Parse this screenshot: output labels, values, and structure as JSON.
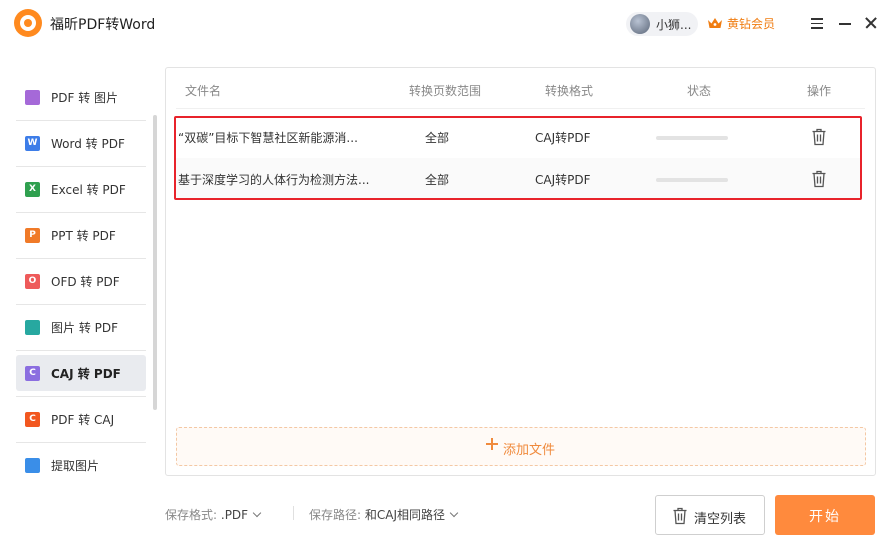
{
  "app": {
    "title": "福昕PDF转Word"
  },
  "user": {
    "name": "小狮..."
  },
  "vip": {
    "label": "黄钻会员",
    "color": "#f07d12"
  },
  "sidebar": {
    "items": [
      {
        "label": "PDF 转 图片",
        "icon": "image-icon",
        "color": "#a569d8",
        "glyph": ""
      },
      {
        "label": "Word 转 PDF",
        "icon": "word-icon",
        "color": "#3d7de8",
        "glyph": "W"
      },
      {
        "label": "Excel 转 PDF",
        "icon": "excel-icon",
        "color": "#2fa04f",
        "glyph": "X"
      },
      {
        "label": "PPT 转 PDF",
        "icon": "ppt-icon",
        "color": "#f07a28",
        "glyph": "P"
      },
      {
        "label": "OFD 转 PDF",
        "icon": "ofd-icon",
        "color": "#ee5a5a",
        "glyph": "O"
      },
      {
        "label": "图片 转 PDF",
        "icon": "picture-icon",
        "color": "#27a8a0",
        "glyph": ""
      },
      {
        "label": "CAJ 转 PDF",
        "icon": "caj-icon",
        "color": "#8b6ee0",
        "glyph": "C",
        "active": true
      },
      {
        "label": "PDF 转 CAJ",
        "icon": "caj-out-icon",
        "color": "#f2571f",
        "glyph": "C"
      },
      {
        "label": "提取图片",
        "icon": "extract-image-icon",
        "color": "#3a8ee8",
        "glyph": ""
      }
    ]
  },
  "table": {
    "headers": [
      "文件名",
      "转换页数范围",
      "转换格式",
      "状态",
      "操作"
    ],
    "rows": [
      {
        "name": "“双碳”目标下智慧社区新能源消...",
        "range": "全部",
        "format": "CAJ转PDF",
        "progress": 0
      },
      {
        "name": "基于深度学习的人体行为检测方法...",
        "range": "全部",
        "format": "CAJ转PDF",
        "progress": 0
      }
    ]
  },
  "add_file": {
    "label": "添加文件"
  },
  "footer": {
    "format_label": "保存格式:",
    "format_value": ".PDF",
    "path_label": "保存路径:",
    "path_value": "和CAJ相同路径",
    "clear_label": "清空列表",
    "start_label": "开始"
  },
  "colors": {
    "accent": "#ff8a3d",
    "highlight": "#e8232b"
  }
}
